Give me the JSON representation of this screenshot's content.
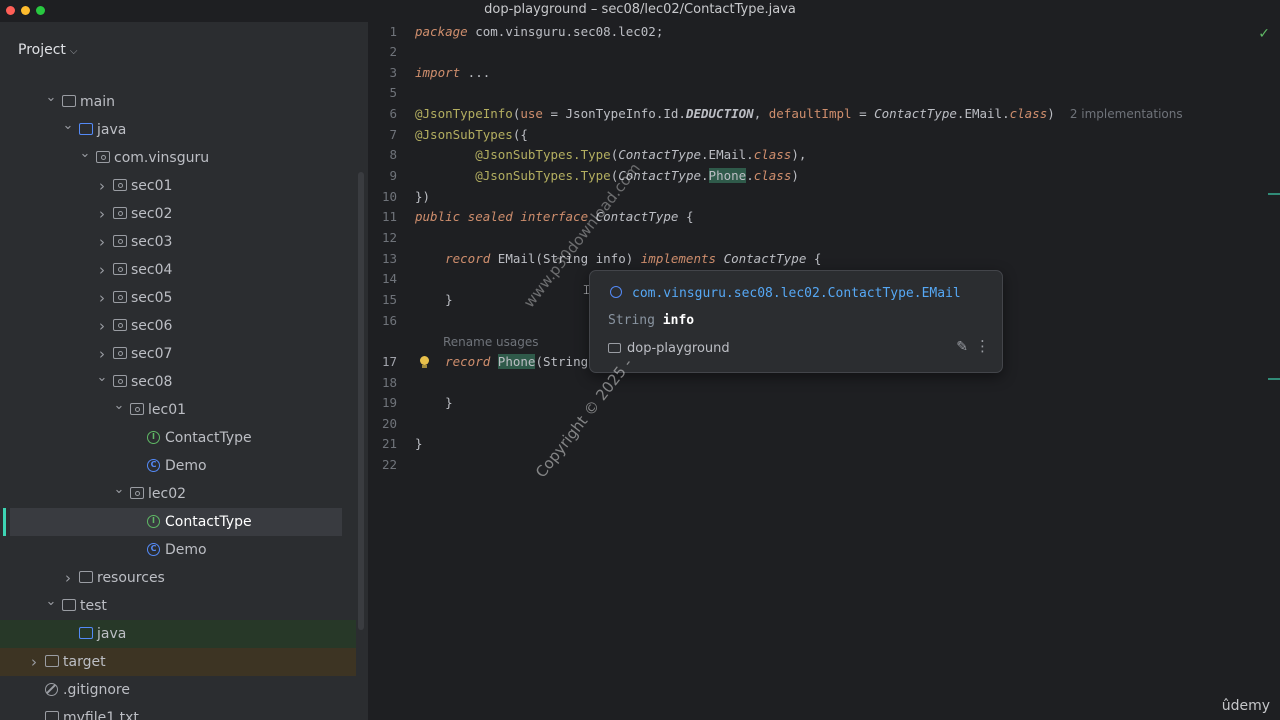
{
  "window": {
    "title": "dop-playground – sec08/lec02/ContactType.java"
  },
  "sidebar": {
    "header": "Project",
    "tree": [
      {
        "label": "main",
        "kind": "folder",
        "indent": 1,
        "expanded": true
      },
      {
        "label": "java",
        "kind": "srcfolder",
        "indent": 2,
        "expanded": true
      },
      {
        "label": "com.vinsguru",
        "kind": "package",
        "indent": 3,
        "expanded": true
      },
      {
        "label": "sec01",
        "kind": "package",
        "indent": 4,
        "expanded": false
      },
      {
        "label": "sec02",
        "kind": "package",
        "indent": 4,
        "expanded": false
      },
      {
        "label": "sec03",
        "kind": "package",
        "indent": 4,
        "expanded": false
      },
      {
        "label": "sec04",
        "kind": "package",
        "indent": 4,
        "expanded": false
      },
      {
        "label": "sec05",
        "kind": "package",
        "indent": 4,
        "expanded": false
      },
      {
        "label": "sec06",
        "kind": "package",
        "indent": 4,
        "expanded": false
      },
      {
        "label": "sec07",
        "kind": "package",
        "indent": 4,
        "expanded": false
      },
      {
        "label": "sec08",
        "kind": "package",
        "indent": 4,
        "expanded": true
      },
      {
        "label": "lec01",
        "kind": "package",
        "indent": 5,
        "expanded": true
      },
      {
        "label": "ContactType",
        "kind": "interface",
        "indent": 6
      },
      {
        "label": "Demo",
        "kind": "class",
        "indent": 6
      },
      {
        "label": "lec02",
        "kind": "package",
        "indent": 5,
        "expanded": true
      },
      {
        "label": "ContactType",
        "kind": "interface",
        "indent": 6,
        "selected": true
      },
      {
        "label": "Demo",
        "kind": "class",
        "indent": 6
      },
      {
        "label": "resources",
        "kind": "resfolder",
        "indent": 2,
        "expanded": false
      },
      {
        "label": "test",
        "kind": "folder",
        "indent": 1,
        "expanded": true
      },
      {
        "label": "java",
        "kind": "testfolder",
        "indent": 2
      },
      {
        "label": "target",
        "kind": "targetfolder",
        "indent": 0,
        "expanded": false
      },
      {
        "label": ".gitignore",
        "kind": "ignore",
        "indent": 0
      },
      {
        "label": "myfile1.txt",
        "kind": "file",
        "indent": 0
      }
    ]
  },
  "editor": {
    "inlay_implementations": "2 implementations",
    "rename_usages": "Rename usages",
    "current_line": 17
  },
  "popup": {
    "fqcn": "com.vinsguru.sec08.lec02.ContactType.EMail",
    "param_type": "String",
    "param_name": "info",
    "module": "dop-playground"
  },
  "watermark": {
    "site": "www.p30download.com",
    "copyright": "Copyright © 2025 -"
  },
  "brand": "ûdemy",
  "colors": {
    "accent": "#3dd4b3",
    "keyword": "#cf8e6d",
    "annotation": "#b3ae60",
    "function": "#56a8f5",
    "constant": "#c77dbb"
  }
}
